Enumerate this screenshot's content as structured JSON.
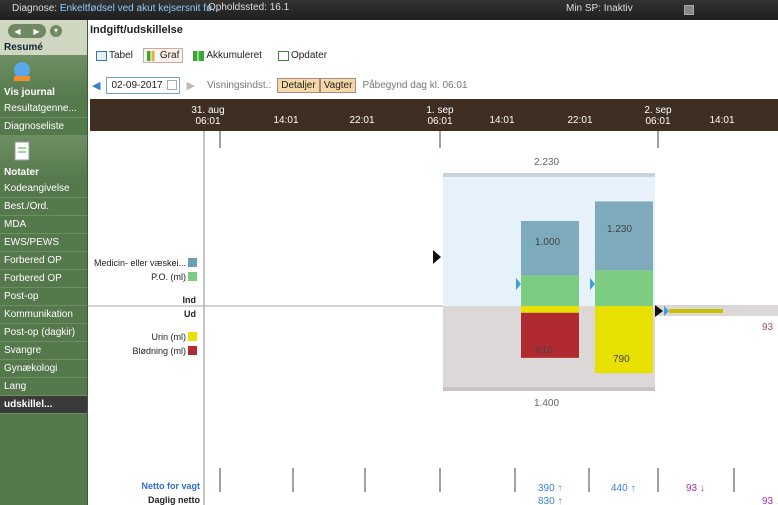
{
  "topbar": {
    "diagnose_label": "Diagnose:",
    "diagnose_value": "Enkeltfødsel ved akut kejsersnit fø...",
    "stay": "Opholdssted: 16.1",
    "sp": "Min SP: Inaktiv",
    "icons": [
      "status-icon",
      "people-icon",
      "printer-icon"
    ]
  },
  "sidebar": {
    "resume_label": "Resumé",
    "vis_journal": "Vis journal",
    "notater": "Notater",
    "items_a": [
      "Resultatgenne...",
      "Diagnoseliste"
    ],
    "items_b": [
      "Kodeangivelse",
      "Best./Ord.",
      "MDA",
      "EWS/PEWS",
      "Forbered OP",
      "Forbered OP",
      "Post-op",
      "Kommunikation",
      "Post-op (dagkir)",
      "Svangre",
      "Gynækologi",
      "Lang"
    ],
    "bottom": "udskillel..."
  },
  "main": {
    "title": "Indgift/udskillelse",
    "tabs": [
      "Tabel",
      "Graf",
      "Akkumuleret"
    ],
    "refresh": "Opdater",
    "date": "02-09-2017",
    "view_label": "Visningsindst.:",
    "view_details": "Detaljer",
    "view_shifts": "Vagter",
    "started_label": "Påbegynd dag kl. 06:01"
  },
  "timeline": {
    "labels": [
      {
        "top": "31. aug",
        "bottom": "06:01"
      },
      {
        "top": "",
        "bottom": "14:01"
      },
      {
        "top": "",
        "bottom": "22:01"
      },
      {
        "top": "1. sep",
        "bottom": "06:01"
      },
      {
        "top": "",
        "bottom": "14:01"
      },
      {
        "top": "",
        "bottom": "22:01"
      },
      {
        "top": "2. sep",
        "bottom": "06:01"
      },
      {
        "top": "",
        "bottom": "14:01"
      }
    ]
  },
  "legend": {
    "intake": [
      {
        "label": "Medicin- eller væskei...",
        "color": "#6a9fb0"
      },
      {
        "label": "P.O. (ml)",
        "color": "#7ccc82"
      }
    ],
    "ind": "Ind",
    "ud": "Ud",
    "output": [
      {
        "label": "Urin (ml)",
        "color": "#e8e000"
      },
      {
        "label": "Blødning (ml)",
        "color": "#b02a30"
      }
    ],
    "netto_vagt": "Netto for vagt",
    "daglig_netto": "Daglig netto"
  },
  "chart_data": {
    "type": "bar",
    "title": "",
    "day_total_intake": "2.230",
    "day_total_output": "1.400",
    "bars": [
      {
        "intake_total": "1.000",
        "output_total": "610",
        "medicine": 640,
        "po": 360,
        "urine": 80,
        "bleeding": 530
      },
      {
        "intake_total": "1.230",
        "output_total": "790",
        "medicine": 810,
        "po": 420,
        "urine": 790,
        "bleeding": 0
      }
    ],
    "netto_values": [
      {
        "value": "390 ↑",
        "color": "#3a7fd4"
      },
      {
        "value": "440 ↑",
        "color": "#3a7fd4"
      },
      {
        "value": "93 ↓",
        "color": "#b02ab0"
      }
    ],
    "daily_netto": [
      {
        "value": "830 ↑",
        "color": "#3a7fd4"
      },
      {
        "value": "93 ↓",
        "color": "#b02ab0"
      }
    ],
    "right_value": "93"
  }
}
